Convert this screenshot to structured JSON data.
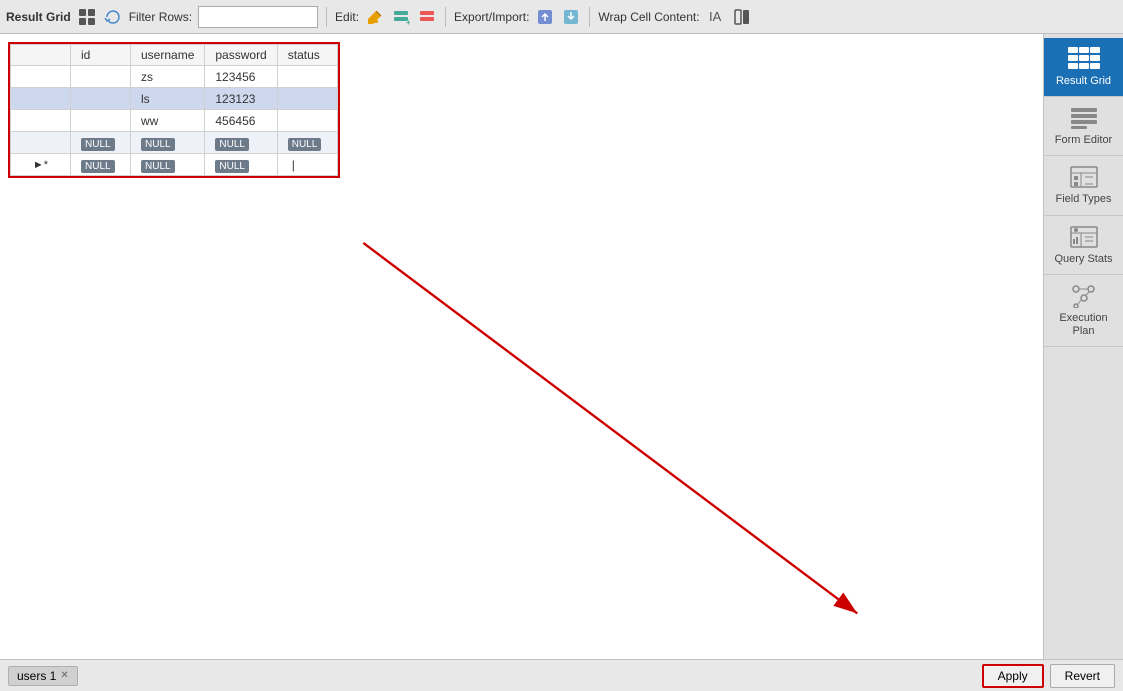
{
  "toolbar": {
    "result_grid_label": "Result Grid",
    "filter_rows_label": "Filter Rows:",
    "edit_label": "Edit:",
    "export_import_label": "Export/Import:",
    "wrap_cell_label": "Wrap Cell Content:"
  },
  "table": {
    "columns": [
      "id",
      "username",
      "password",
      "status"
    ],
    "rows": [
      {
        "id": "",
        "username": "zs",
        "password": "123456",
        "status": "",
        "selected": false
      },
      {
        "id": "",
        "username": "ls",
        "password": "123123",
        "status": "",
        "selected": true
      },
      {
        "id": "",
        "username": "ww",
        "password": "456456",
        "status": "",
        "selected": false
      },
      {
        "id": "NULL",
        "username": "NULL",
        "password": "NULL",
        "status": "NULL",
        "selected": false,
        "nullRow": true
      }
    ],
    "new_row": {
      "id": "NULL",
      "username": "NULL",
      "password": "NULL",
      "status": ""
    }
  },
  "sidebar": {
    "items": [
      {
        "label": "Result Grid",
        "active": true
      },
      {
        "label": "Form Editor",
        "active": false
      },
      {
        "label": "Field Types",
        "active": false
      },
      {
        "label": "Query Stats",
        "active": false
      },
      {
        "label": "Execution Plan",
        "active": false
      }
    ]
  },
  "bottom": {
    "tab_label": "users 1",
    "apply_label": "Apply",
    "revert_label": "Revert"
  }
}
